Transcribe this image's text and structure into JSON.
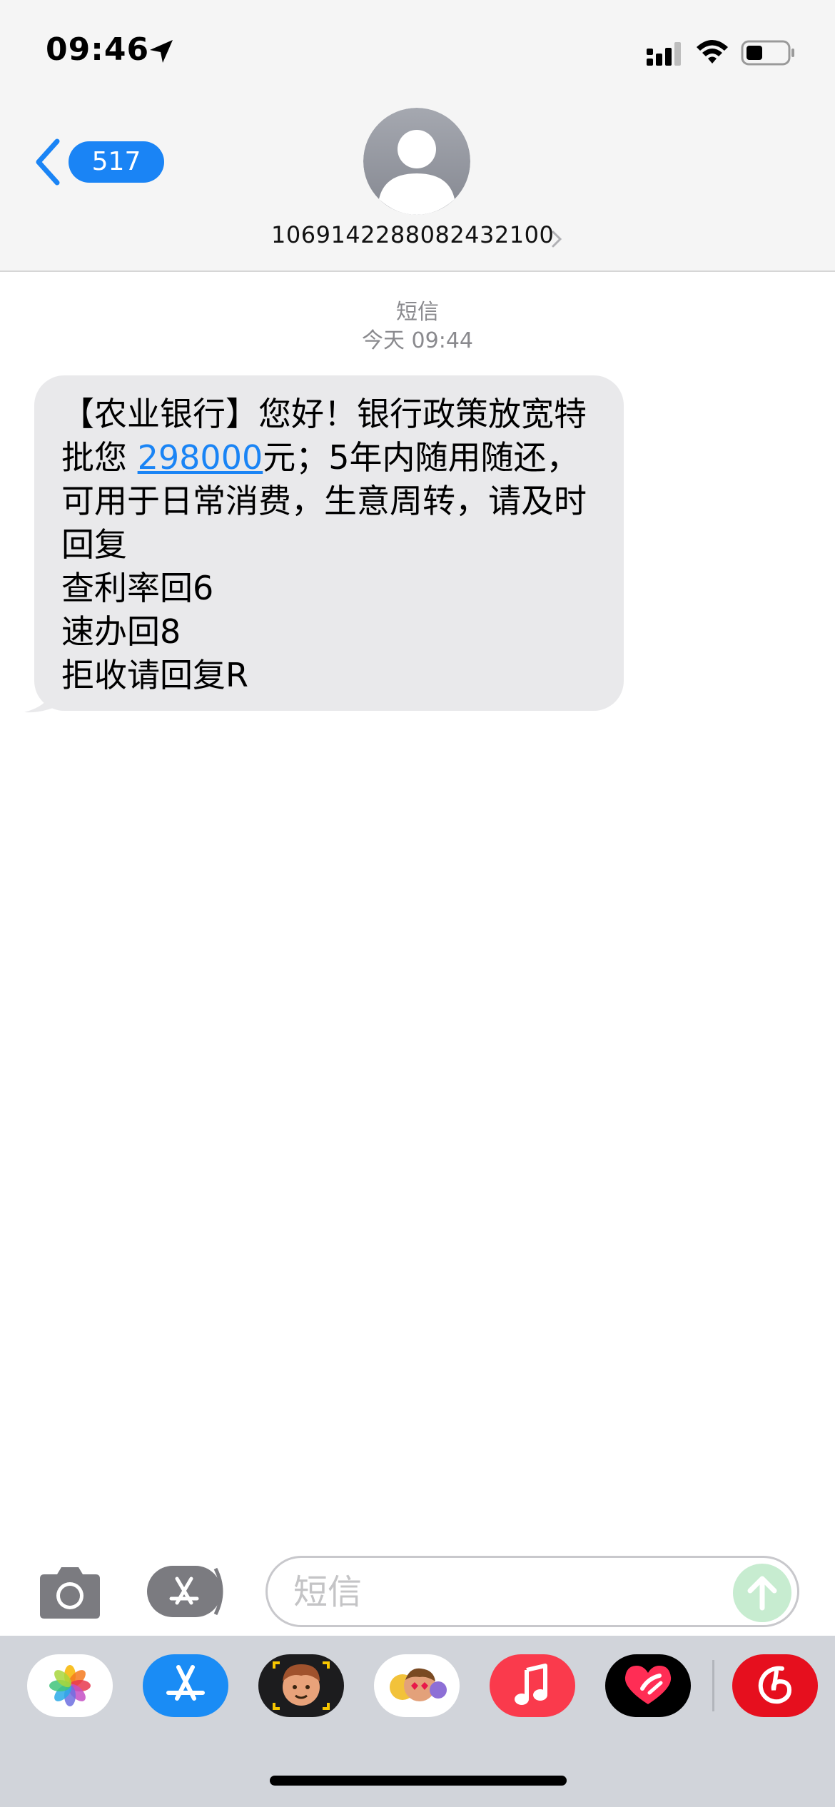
{
  "status_bar": {
    "time": "09:46",
    "icons": [
      "location-arrow-icon",
      "signal-icon",
      "wifi-icon",
      "battery-icon"
    ]
  },
  "header": {
    "back_count": "517",
    "contact_number": "1069142288082432100",
    "icons": [
      "back-chevron-icon",
      "person-icon",
      "chevron-right-icon"
    ]
  },
  "conversation": {
    "service_label": "短信",
    "timestamp": "今天 09:44",
    "message": {
      "part1": "【农业银行】您好！银行政策放宽特批您 ",
      "link": "298000",
      "part2": "元；5年内随用随还，可用于日常消费，生意周转，请及时回复\n查利率回6\n速办回8\n拒收请回复R"
    }
  },
  "input_bar": {
    "placeholder": "短信",
    "icons": [
      "camera-icon",
      "app-store-icon",
      "send-arrow-icon"
    ]
  },
  "app_drawer": {
    "apps": [
      {
        "name": "photos-icon",
        "color": "#ffffff"
      },
      {
        "name": "app-store-icon",
        "color": "#1a8cf5"
      },
      {
        "name": "memoji-icon",
        "color": "#1c1c1e"
      },
      {
        "name": "animoji-stickers-icon",
        "color": "#ffffff"
      },
      {
        "name": "music-icon",
        "color": "#fa3a4c"
      },
      {
        "name": "digital-touch-icon",
        "color": "#000000"
      },
      {
        "name": "netease-music-icon",
        "color": "#e60f1e"
      }
    ]
  },
  "colors": {
    "accent_blue": "#1a84f5",
    "bubble_gray": "#e9e9eb",
    "header_bg": "#f5f5f5",
    "send_green": "#c7ecd0",
    "drawer_bg": "#d1d4da"
  }
}
